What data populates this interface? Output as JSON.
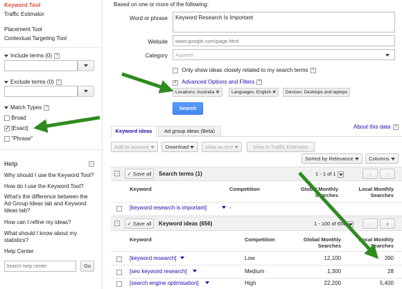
{
  "sidebar": {
    "tool_active": "Keyword Tool",
    "tool_traffic": "Traffic Estimator",
    "tool_placement": "Placement Tool",
    "tool_contextual": "Contextual Targeting Tool",
    "include_label": "Include terms (0)",
    "exclude_label": "Exclude terms (0)",
    "match_types_label": "Match Types",
    "match_broad": "Broad",
    "match_exact": "[Exact]",
    "match_phrase": "\"Phrase\"",
    "help_title": "Help",
    "help_links": [
      "Why should I use the Keyword Tool?",
      "How do I use the Keyword Tool?",
      "What's the difference between the Ad Group Ideas tab and Keyword Ideas tab?",
      "How can I refine my ideas?",
      "What should I know about my statistics?"
    ],
    "help_center": "Help Center",
    "search_placeholder": "Search help center",
    "go_label": "Go"
  },
  "form": {
    "intro": "Based on one or more of the following:",
    "word_label": "Word or phrase",
    "word_value": "Keyword Research Is Important",
    "website_label": "Website",
    "website_placeholder": "www.google.com/page.html",
    "category_label": "Category",
    "category_value": "Apparel",
    "only_ideas_label": "Only show ideas closely related to my search terms",
    "advanced_label": "Advanced Options and Filters",
    "chip_locations": "Locations: Australia",
    "chip_languages": "Languages: English",
    "chip_devices": "Devices: Desktops and laptops",
    "search_button": "Search"
  },
  "tabs": {
    "keyword_ideas": "Keyword ideas",
    "ad_group_ideas": "Ad group ideas (Beta)",
    "about_data": "About this data"
  },
  "toolbar": {
    "add_to_account": "Add to account",
    "download": "Download",
    "view_as_text": "View as text",
    "view_in_traffic": "View in Traffic Estimator",
    "sorted_by": "Sorted by Relevance",
    "columns": "Columns"
  },
  "search_terms": {
    "save_all": "Save all",
    "title": "Search terms (1)",
    "pagination": "1 - 1 of 1",
    "headers": {
      "keyword": "Keyword",
      "competition": "Competition",
      "global": "Global Monthly Searches",
      "local": "Local Monthly Searches"
    },
    "rows": [
      {
        "keyword": "[keyword research is important]",
        "competition": "-",
        "global": "",
        "local": ""
      }
    ]
  },
  "keyword_ideas": {
    "save_all": "Save all",
    "title": "Keyword ideas (656)",
    "pagination": "1 - 100 of 656",
    "headers": {
      "keyword": "Keyword",
      "competition": "Competition",
      "global": "Global Monthly Searches",
      "local": "Local Monthly Searches"
    },
    "rows": [
      {
        "keyword": "[keyword research]",
        "competition": "Low",
        "global": "12,100",
        "local": "390"
      },
      {
        "keyword": "[seo keyword research]",
        "competition": "Medium",
        "global": "1,300",
        "local": "28"
      },
      {
        "keyword": "[search engine optimisation]",
        "competition": "High",
        "global": "22,200",
        "local": "5,400"
      }
    ]
  },
  "colors": {
    "link": "#1a0dab",
    "active_tool": "#dd4b39",
    "search_button": "#4d90fe",
    "annotation_arrow": "#2e8b1e"
  }
}
